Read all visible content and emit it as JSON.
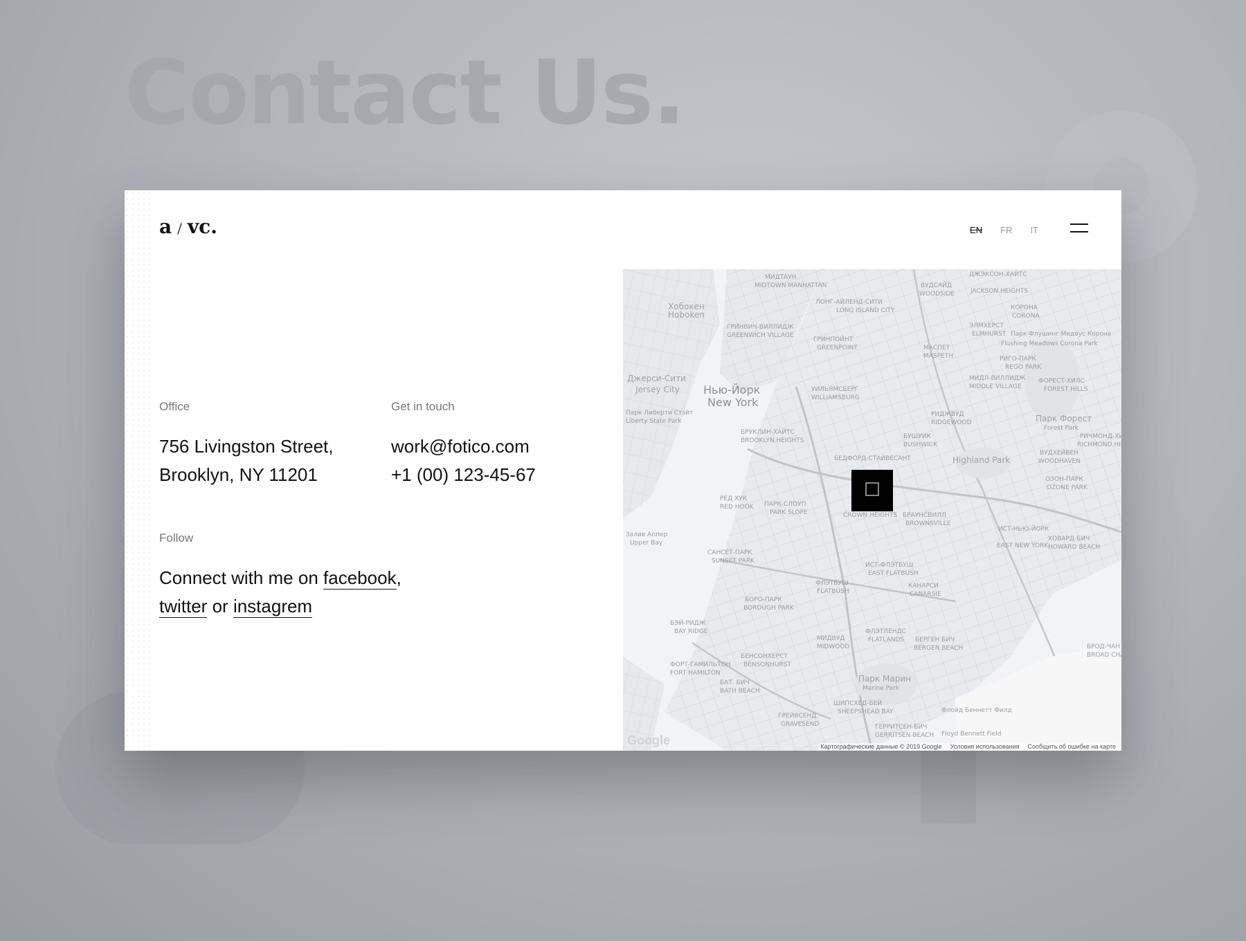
{
  "background": {
    "title": "Contact Us."
  },
  "header": {
    "logo_a": "a",
    "logo_sep": "/",
    "logo_b": "vc.",
    "languages": [
      "EN",
      "FR",
      "IT"
    ],
    "active_language": "EN"
  },
  "office": {
    "label": "Office",
    "line1": "756 Livingston Street,",
    "line2": "Brooklyn, NY 11201"
  },
  "contact": {
    "label": "Get in touch",
    "email": "work@fotico.com",
    "phone": "+1 (00) 123-45-67"
  },
  "follow": {
    "label": "Follow",
    "prefix": "Connect with me on",
    "link1": "facebook",
    "comma": ",",
    "link2": "twitter",
    "or": "or",
    "link3": "instagrem"
  },
  "map": {
    "labels": {
      "new_york_ru": "Нью-Йорк",
      "new_york": "New York",
      "jersey_ru": "Джерси-Сити",
      "jersey": "Jersey City",
      "hoboken_ru": "Хобокен",
      "hoboken": "Hoboken",
      "midtown_ru": "МИДТАУН",
      "midtown": "MIDTOWN MANHATTAN",
      "lic_ru": "ЛОНГ-АЙЛЕНД-СИТИ",
      "lic": "LONG ISLAND CITY",
      "greenwich_ru": "ГРИНВИЧ-ВИЛЛИДЖ",
      "greenwich": "GREENWICH VILLAGE",
      "greenpoint_ru": "ГРИНПОЙНТ",
      "greenpoint": "GREENPOINT",
      "williamsburg_ru": "УИЛЬЯМСБЕРГ",
      "williamsburg": "WILLIAMSBURG",
      "brooklyn_heights_ru": "БРУКЛИН-ХАЙТС",
      "brooklyn_heights": "BROOKLYN HEIGHTS",
      "bedford_ru": "БЕДФОРД-СТАЙВЕСАНТ",
      "bushwick_ru": "БУШУИК",
      "bushwick": "BUSHWICK",
      "ridgewood_ru": "РИДЖВУД",
      "ridgewood": "RIDGEWOOD",
      "red_hook_ru": "РЕД ХУК",
      "red_hook": "RED HOOK",
      "park_slope_ru": "ПАРК-СЛОУП",
      "park_slope": "PARK SLOPE",
      "crown_heights": "CROWN HEIGHTS",
      "brownsville_ru": "БРАУНСВИЛЛ",
      "brownsville": "BROWNSVILLE",
      "highland": "Highland Park",
      "upper_bay_ru": "Залив Аппер",
      "upper_bay": "Upper Bay",
      "sunset_ru": "САНСЕТ-ПАРК",
      "sunset": "SUNSET PARK",
      "east_flatbush_ru": "ИСТ-ФЛЭТБУШ",
      "east_flatbush": "EAST FLATBUSH",
      "flatbush_ru": "ФЛЭТБУШ",
      "flatbush": "FLATBUSH",
      "borough_park_ru": "БОРО-ПАРК",
      "borough_park": "BOROUGH PARK",
      "canarsie_ru": "КАНАРСИ",
      "canarsie": "CANARSIE",
      "bay_ridge_ru": "БЭЙ-РИДЖ",
      "bay_ridge": "BAY RIDGE",
      "midwood_ru": "МИДВУД",
      "midwood": "MIDWOOD",
      "flatlands_ru": "ФЛЭТЛЕНДС",
      "flatlands": "FLATLANDS",
      "bergen_ru": "БЕРГЕН БИЧ",
      "bergen": "BERGEN BEACH",
      "bensonhurst_ru": "БЕНСОНХЕРСТ",
      "bensonhurst": "BENSONHURST",
      "fort_ru": "ФОРТ-ГАМИЛЬТОН",
      "fort": "FORT HAMILTON",
      "bath_ru": "БАТ. БИЧ",
      "bath": "BATH BEACH",
      "marine_ru": "Парк Марин",
      "marine": "Marine Park",
      "sheepshead_ru": "ШИПСХЕД-БЕЙ",
      "sheepshead": "SHEEPSHEAD BAY",
      "gravesend_ru": "ГРЕЙВСЕНД",
      "gravesend": "GRAVESEND",
      "gerritsen_ru": "ГЕРРИТСЕН-БИЧ",
      "gerritsen": "GERRITSEN BEACH",
      "floyd_ru": "Флойд Беннетт Филд",
      "floyd": "Floyd Bennett Field",
      "woodside_ru": "ВУДСАЙД",
      "woodside": "WOODSIDE",
      "jackson_ru": "ДЖЭКСОН-ХАЙТС",
      "jackson": "JACKSON HEIGHTS",
      "corona_ru": "КОРОНА",
      "corona": "CORONA",
      "elmhurst_ru": "ЭЛМХЕРСТ",
      "elmhurst": "ELMHURST",
      "maspeth_ru": "МАСПЕТ",
      "maspeth": "MASPETH",
      "rego_ru": "РИГО-ПАРК",
      "rego": "REGO PARK",
      "middle_village_ru": "МИДЛ-ВИЛЛИДЖ",
      "middle_village": "MIDDLE VILLAGE",
      "forest_hills_ru": "ФОРЕСТ-ХИЛС",
      "forest_hills": "FOREST HILLS",
      "forest_park_ru": "Парк Форест",
      "forest_park": "Forest Park",
      "richmond_ru": "РИЧМОНД-ХИЛЛ",
      "richmond": "RICHMOND HILL",
      "woodhaven_ru": "ВУДХЕЙВЕН",
      "woodhaven": "WOODHAVEN",
      "ozone_ru": "ОЗОН-ПАРК",
      "ozone": "OZONE PARK",
      "east_ny_ru": "ИСТ-НЬЮ-ЙОРК",
      "east_ny": "EAST NEW YORK",
      "howard_ru": "ХОВАРД-БИЧ",
      "howard": "HOWARD BEACH",
      "broad_ru": "БРОД-ЧАН",
      "broad": "BROAD CHA",
      "flushing_ru": "Парк Флушинг Медоус Корона",
      "flushing": "Flushing Meadows Corona Park",
      "liberty_ru": "Парк Либерти Стэйт",
      "liberty": "Liberty State Park"
    },
    "google": "Google",
    "attribution": [
      "Картографические данные © 2019 Google",
      "Условия использования",
      "Сообщить об ошибке на карте"
    ]
  }
}
